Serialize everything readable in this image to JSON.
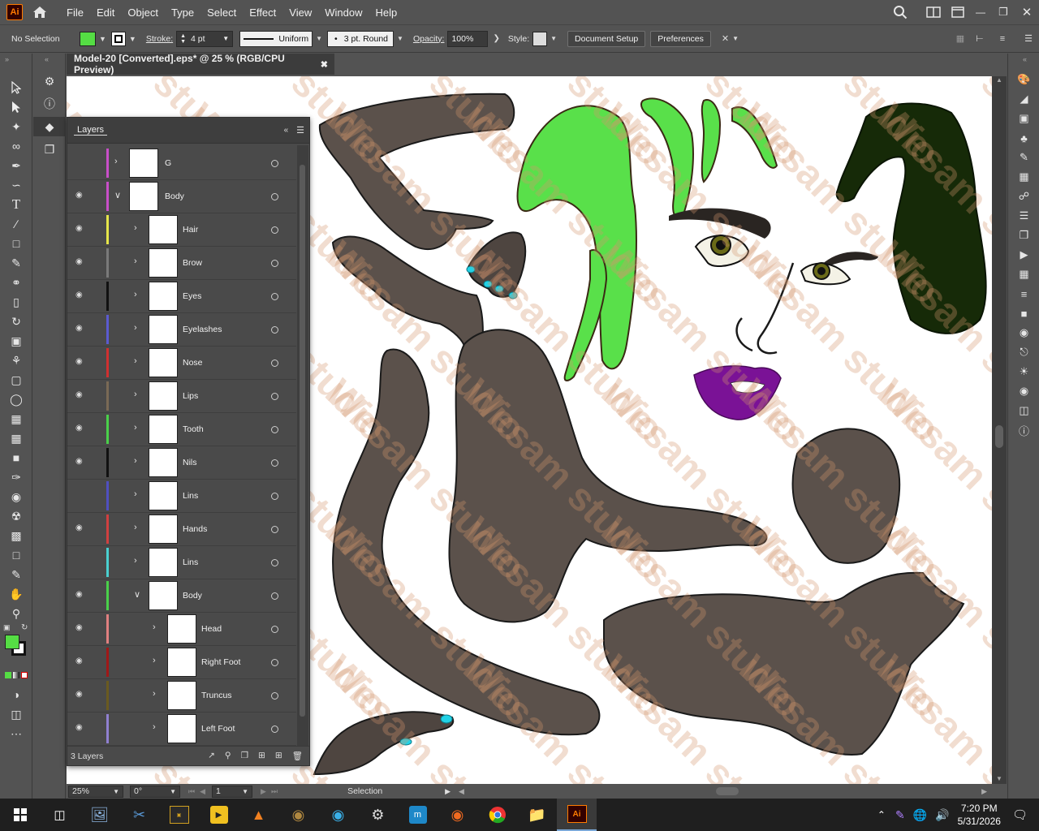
{
  "app": {
    "logo": "Ai",
    "menu": [
      "File",
      "Edit",
      "Object",
      "Type",
      "Select",
      "Effect",
      "View",
      "Window",
      "Help"
    ]
  },
  "control_bar": {
    "selection_label": "No Selection",
    "fill_color": "#55dd44",
    "stroke_label": "Stroke:",
    "stroke_weight": "4 pt",
    "stroke_profile": "Uniform",
    "brush": "3 pt. Round",
    "opacity_label": "Opacity:",
    "opacity_value": "100%",
    "style_label": "Style:",
    "document_setup_label": "Document Setup",
    "preferences_label": "Preferences"
  },
  "document": {
    "tab_title": "Model-20 [Converted].eps* @ 25 % (RGB/CPU Preview)"
  },
  "layers_panel": {
    "title": "Layers",
    "footer_count": "3 Layers",
    "rows": [
      {
        "name": "G",
        "color": "#c94fc9",
        "visible": false,
        "expanded": false,
        "indent": 0
      },
      {
        "name": "Body",
        "color": "#c94fc9",
        "visible": true,
        "expanded": true,
        "indent": 0
      },
      {
        "name": "Hair",
        "color": "#e6e64a",
        "visible": true,
        "expanded": false,
        "indent": 1
      },
      {
        "name": "Brow",
        "color": "#7a7a7a",
        "visible": true,
        "expanded": false,
        "indent": 1
      },
      {
        "name": "Eyes",
        "color": "#111111",
        "visible": true,
        "expanded": false,
        "indent": 1
      },
      {
        "name": "Eyelashes",
        "color": "#5b5bd0",
        "visible": true,
        "expanded": false,
        "indent": 1
      },
      {
        "name": "Nose",
        "color": "#d03030",
        "visible": true,
        "expanded": false,
        "indent": 1
      },
      {
        "name": "Lips",
        "color": "#7a6a55",
        "visible": true,
        "expanded": false,
        "indent": 1
      },
      {
        "name": "Tooth",
        "color": "#4ad04a",
        "visible": true,
        "expanded": false,
        "indent": 1
      },
      {
        "name": "Nils",
        "color": "#111111",
        "visible": true,
        "expanded": false,
        "indent": 1
      },
      {
        "name": "Lins",
        "color": "#5050c0",
        "visible": false,
        "expanded": false,
        "indent": 1
      },
      {
        "name": "Hands",
        "color": "#d04040",
        "visible": true,
        "expanded": false,
        "indent": 1
      },
      {
        "name": "Lins",
        "color": "#4ad0d0",
        "visible": false,
        "expanded": false,
        "indent": 1
      },
      {
        "name": "Body",
        "color": "#4ad04a",
        "visible": true,
        "expanded": true,
        "indent": 1
      },
      {
        "name": "Head",
        "color": "#e08080",
        "visible": true,
        "expanded": false,
        "indent": 2
      },
      {
        "name": "Right Foot",
        "color": "#a01818",
        "visible": true,
        "expanded": false,
        "indent": 2
      },
      {
        "name": "Truncus",
        "color": "#6a5a20",
        "visible": true,
        "expanded": false,
        "indent": 2
      },
      {
        "name": "Left Foot",
        "color": "#9080d0",
        "visible": true,
        "expanded": false,
        "indent": 2
      }
    ]
  },
  "status_bar": {
    "zoom": "25%",
    "rotation": "0°",
    "artboard": "1",
    "tool": "Selection"
  },
  "taskbar": {
    "time": "7:20 PM",
    "date": "5/31/2026"
  },
  "watermark": "Wesam studio"
}
